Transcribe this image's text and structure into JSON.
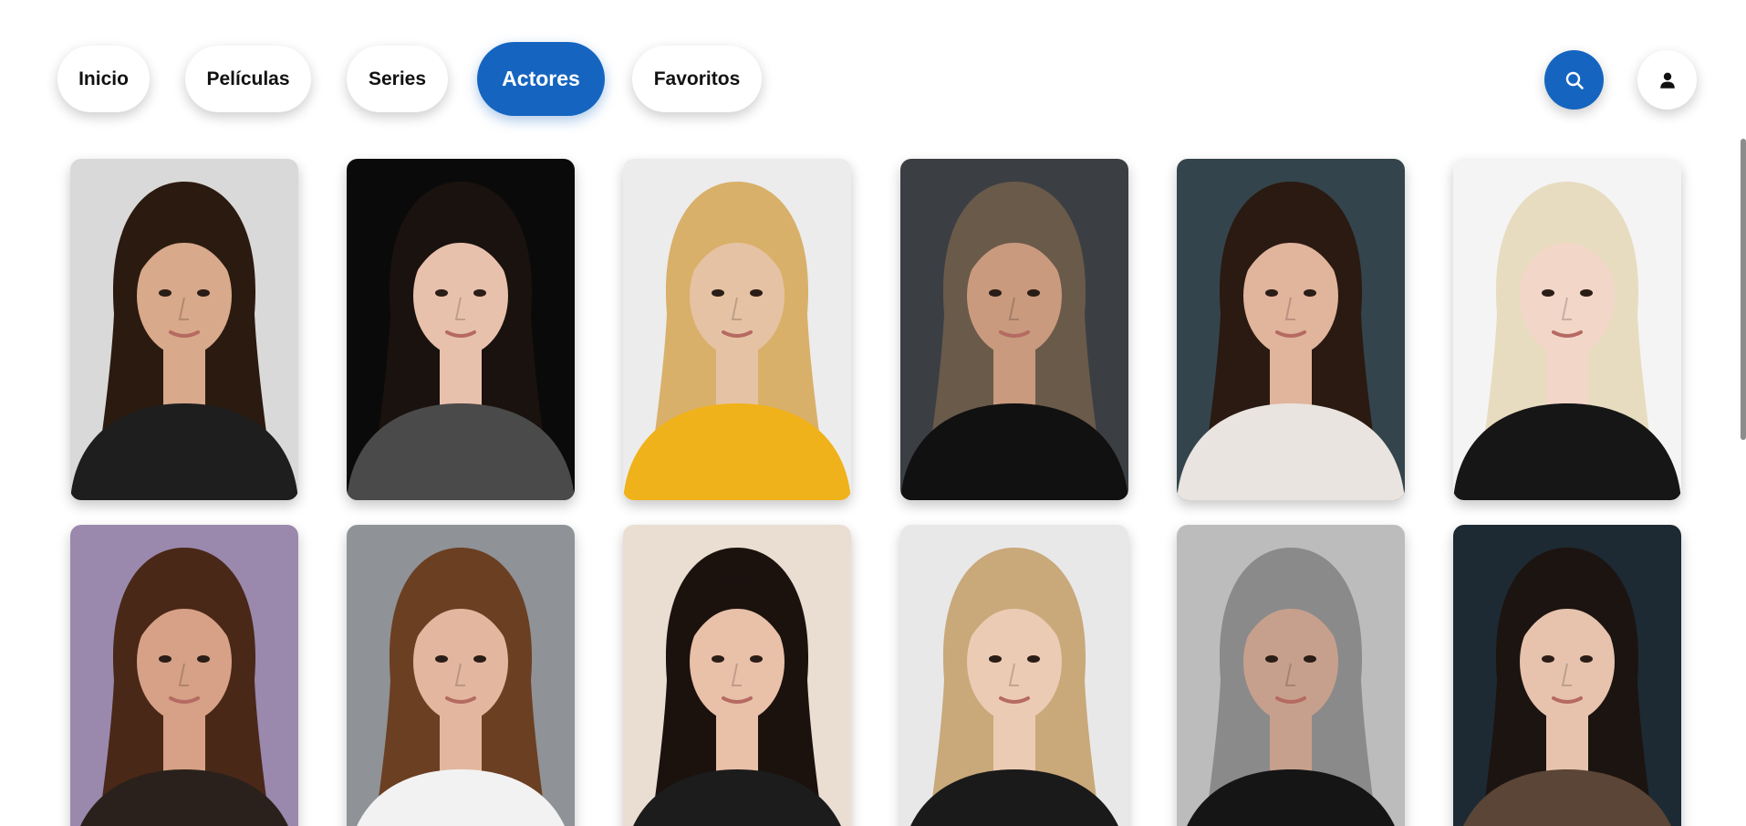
{
  "nav": {
    "items": [
      {
        "label": "Inicio",
        "active": false
      },
      {
        "label": "Películas",
        "active": false
      },
      {
        "label": "Series",
        "active": false
      },
      {
        "label": "Actores",
        "active": true
      },
      {
        "label": "Favoritos",
        "active": false
      }
    ],
    "search_icon": "search-icon",
    "user_icon": "user-icon"
  },
  "colors": {
    "accent": "#1565c0",
    "background": "#ffffff",
    "text": "#111111"
  },
  "actors": [
    {
      "icon": "actor-photo",
      "bg": "#d9d9d9",
      "hair": "#2b1a10",
      "skin": "#d8a98a",
      "clothes": "#1e1e1e"
    },
    {
      "icon": "actor-photo",
      "bg": "#0a0a0a",
      "hair": "#1a120e",
      "skin": "#e8c1ad",
      "clothes": "#4a4a4a"
    },
    {
      "icon": "actor-photo",
      "bg": "#ececec",
      "hair": "#d9b06a",
      "skin": "#e6c2a4",
      "clothes": "#f0b21a"
    },
    {
      "icon": "actor-photo",
      "bg": "#3b3f44",
      "hair": "#6a5a4a",
      "skin": "#c99a7e",
      "clothes": "#111111"
    },
    {
      "icon": "actor-photo",
      "bg": "#34444c",
      "hair": "#2a1a12",
      "skin": "#e1b49c",
      "clothes": "#e9e4e0"
    },
    {
      "icon": "actor-photo",
      "bg": "#f4f4f4",
      "hair": "#e8dcc0",
      "skin": "#f2d6c8",
      "clothes": "#161616"
    },
    {
      "icon": "actor-photo",
      "bg": "#9a89ad",
      "hair": "#4a2818",
      "skin": "#d6a186",
      "clothes": "#2a211c"
    },
    {
      "icon": "actor-photo",
      "bg": "#8f9297",
      "hair": "#6b3f22",
      "skin": "#e3b79f",
      "clothes": "#f2f2f2"
    },
    {
      "icon": "actor-photo",
      "bg": "#eaddd2",
      "hair": "#1b120e",
      "skin": "#e9c0a8",
      "clothes": "#1c1c1c"
    },
    {
      "icon": "actor-photo",
      "bg": "#e8e8e8",
      "hair": "#c9a87a",
      "skin": "#eccbb4",
      "clothes": "#1a1a1a"
    },
    {
      "icon": "actor-photo",
      "bg": "#bcbcbc",
      "hair": "#8a8a8a",
      "skin": "#c7a08d",
      "clothes": "#151515"
    },
    {
      "icon": "actor-photo",
      "bg": "#1d2a33",
      "hair": "#1c1410",
      "skin": "#e7c3ad",
      "clothes": "#5a4536"
    }
  ]
}
